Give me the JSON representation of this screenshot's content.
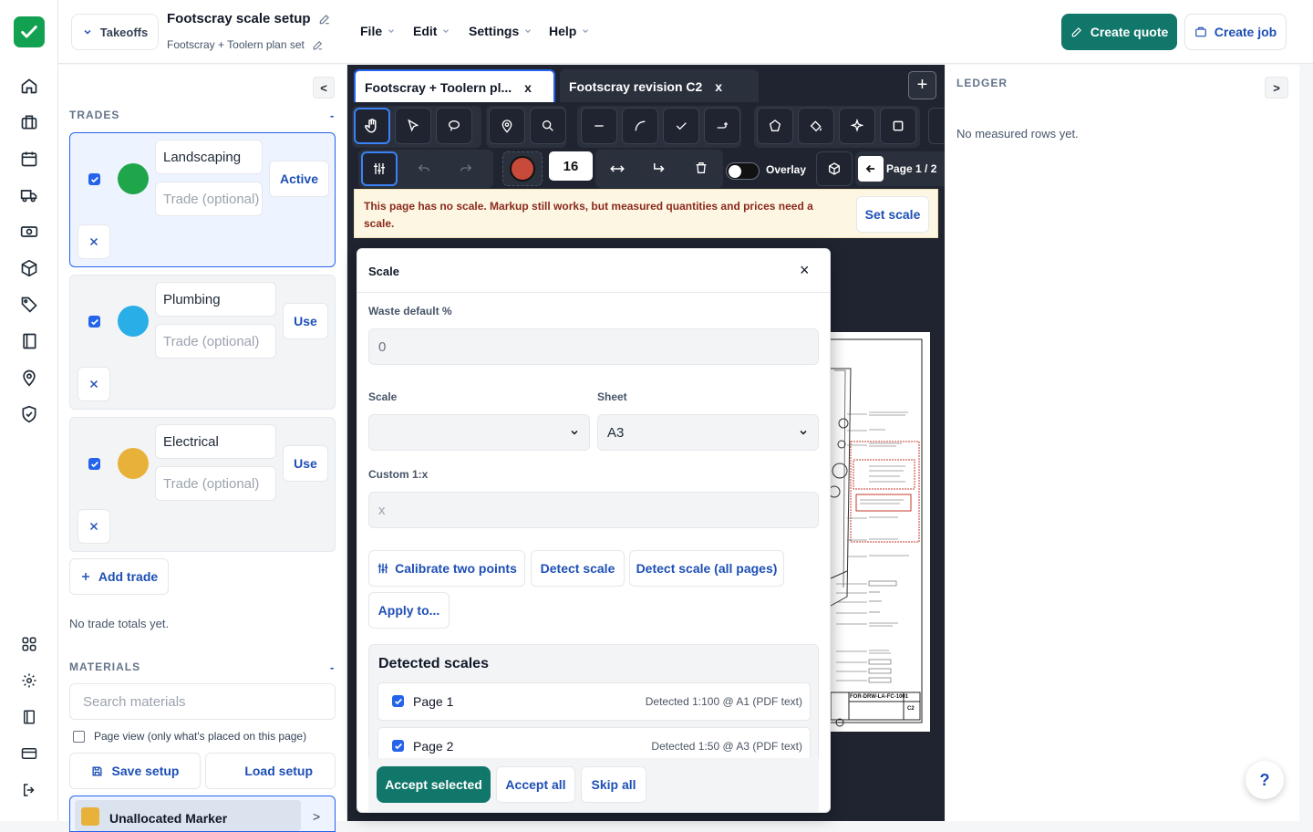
{
  "nav": {
    "icons": [
      "home-icon",
      "briefcase-icon",
      "calendar-icon",
      "truck-icon",
      "cash-icon",
      "box-icon",
      "tag-icon",
      "book-icon",
      "location-pin-icon",
      "shield-check-icon"
    ],
    "bottom_icons": [
      "grid-icon",
      "gear-icon",
      "book-open-icon",
      "card-icon",
      "logout-icon"
    ]
  },
  "header": {
    "takeoffs_label": "Takeoffs",
    "title": "Footscray scale setup",
    "subtitle": "Footscray + Toolern plan set",
    "menus": [
      "File",
      "Edit",
      "Settings",
      "Help"
    ],
    "create_quote": "Create quote",
    "create_job": "Create job"
  },
  "trades": {
    "heading": "TRADES",
    "collapse": "<",
    "items": [
      {
        "name": "Landscaping",
        "trade_placeholder": "Trade (optional)",
        "action": "Active",
        "color": "#1fa64a",
        "checked": true
      },
      {
        "name": "Plumbing",
        "trade_placeholder": "Trade (optional)",
        "action": "Use",
        "color": "#2aaee8",
        "checked": true
      },
      {
        "name": "Electrical",
        "trade_placeholder": "Trade (optional)",
        "action": "Use",
        "color": "#e8b23a",
        "checked": true
      }
    ],
    "add_trade": "Add trade",
    "no_totals": "No trade totals yet.",
    "materials_heading": "MATERIALS",
    "search_placeholder": "Search materials",
    "page_view_label": "Page view (only what's placed on this page)",
    "save_setup": "Save setup",
    "load_setup": "Load setup",
    "unallocated": "Unallocated Marker",
    "unallocated_color": "#e8b23a"
  },
  "viewer": {
    "tabs": [
      {
        "label": "Footscray + Toolern pl...",
        "close": "x",
        "active": true
      },
      {
        "label": "Footscray revision C2",
        "close": "x",
        "active": false
      }
    ],
    "add_tab": "+",
    "stroke_width": "16",
    "overlay_label": "Overlay",
    "page_label": "Page 1 / 2",
    "marker_color": "#c84a3a",
    "banner_text": "This page has no scale. Markup still works, but measured quantities and prices need a scale.",
    "set_scale": "Set scale",
    "drawing_code": "FOR-DRW-LA-FC-1001",
    "drawing_rev": "C2"
  },
  "scale_modal": {
    "title": "Scale",
    "close": "×",
    "waste_label": "Waste default %",
    "waste_value": "0",
    "scale_label": "Scale",
    "scale_value": "",
    "sheet_label": "Sheet",
    "sheet_value": "A3",
    "custom_label": "Custom 1:x",
    "custom_placeholder": "x",
    "calibrate": "Calibrate two points",
    "detect": "Detect scale",
    "detect_all": "Detect scale (all pages)",
    "apply_to": "Apply to...",
    "detected_heading": "Detected scales",
    "detected": [
      {
        "page": "Page 1",
        "info": "Detected 1:100 @ A1 (PDF text)",
        "checked": true
      },
      {
        "page": "Page 2",
        "info": "Detected 1:50 @ A3 (PDF text)",
        "checked": true
      }
    ],
    "accept_selected": "Accept selected",
    "accept_all": "Accept all",
    "skip_all": "Skip all"
  },
  "ledger": {
    "heading": "LEDGER",
    "expand": ">",
    "empty": "No measured rows yet."
  },
  "help_label": "?"
}
